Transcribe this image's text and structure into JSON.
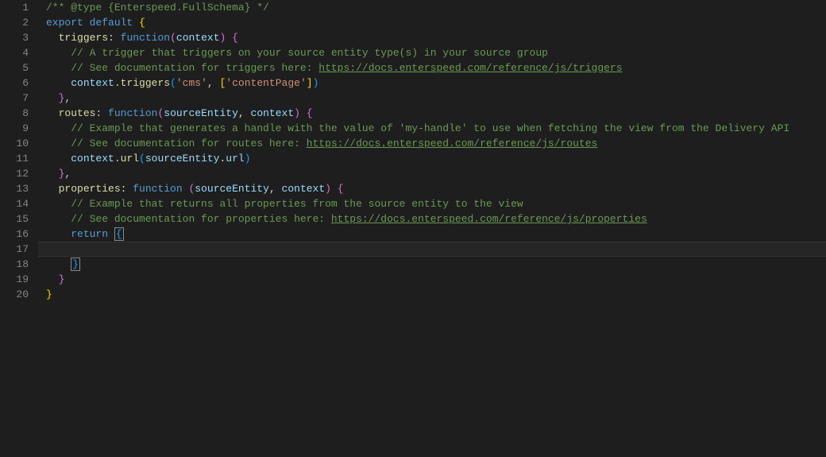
{
  "editor": {
    "lineNumbers": [
      "1",
      "2",
      "3",
      "4",
      "5",
      "6",
      "7",
      "8",
      "9",
      "10",
      "11",
      "12",
      "13",
      "14",
      "15",
      "16",
      "17",
      "18",
      "19",
      "20"
    ],
    "code": {
      "l1_comment": "/** @type {Enterspeed.FullSchema} */",
      "l2_export": "export",
      "l2_default": "default",
      "l3_triggers": "triggers",
      "l3_function": "function",
      "l3_context": "context",
      "l4_comment": "// A trigger that triggers on your source entity type(s) in your source group",
      "l5_comment_prefix": "// See documentation for triggers here: ",
      "l5_link": "https://docs.enterspeed.com/reference/js/triggers",
      "l6_context": "context",
      "l6_triggers": "triggers",
      "l6_cms": "'cms'",
      "l6_contentPage": "'contentPage'",
      "l8_routes": "routes",
      "l8_function": "function",
      "l8_sourceEntity": "sourceEntity",
      "l8_context": "context",
      "l9_comment": "// Example that generates a handle with the value of 'my-handle' to use when fetching the view from the Delivery API",
      "l10_comment_prefix": "// See documentation for routes here: ",
      "l10_link": "https://docs.enterspeed.com/reference/js/routes",
      "l11_context": "context",
      "l11_url": "url",
      "l11_sourceEntity": "sourceEntity",
      "l11_url2": "url",
      "l13_properties": "properties",
      "l13_function": "function",
      "l13_sourceEntity": "sourceEntity",
      "l13_context": "context",
      "l14_comment": "// Example that returns all properties from the source entity to the view",
      "l15_comment_prefix": "// See documentation for properties here: ",
      "l15_link": "https://docs.enterspeed.com/reference/js/properties",
      "l16_return": "return"
    }
  }
}
